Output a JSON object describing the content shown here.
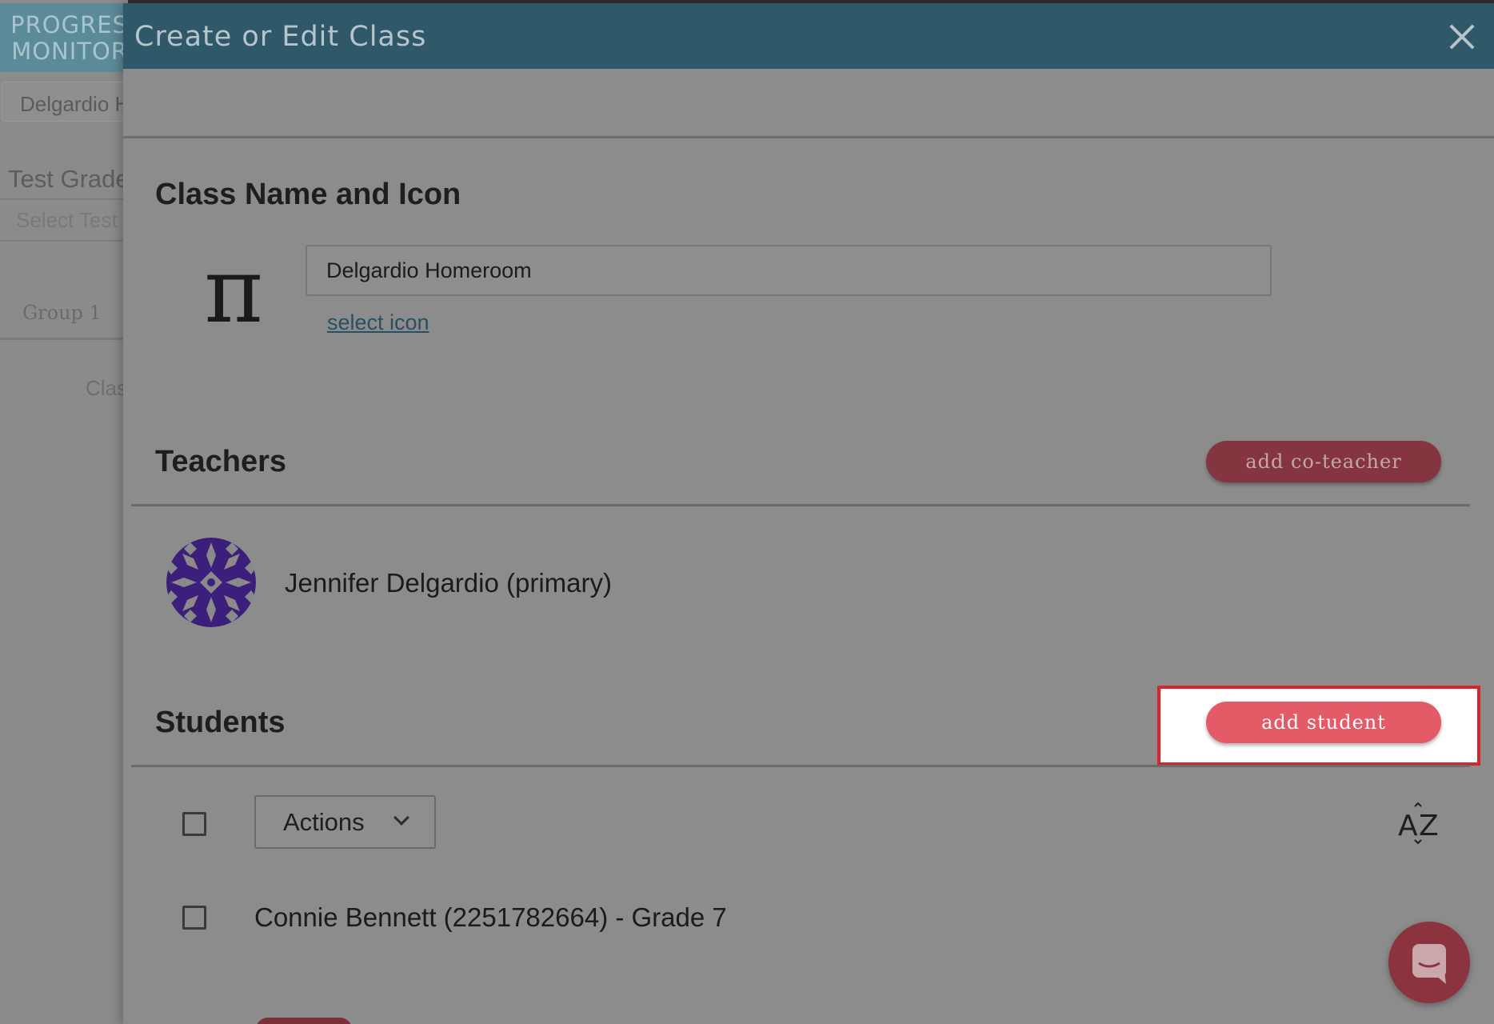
{
  "background": {
    "logo_line1": "PROGRES",
    "logo_line2": "MONITOR",
    "school_field": "Delgardio H",
    "test_label": "Test Grade",
    "select_placeholder": "Select Test",
    "group_label": "Group 1",
    "class_label": "Clas"
  },
  "modal": {
    "title": "Create or Edit Class",
    "class_section": {
      "title": "Class Name and Icon",
      "icon": "pi-icon",
      "icon_glyph": "π",
      "class_name_value": "Delgardio Homeroom",
      "select_icon_link": "select icon"
    },
    "teachers_section": {
      "title": "Teachers",
      "add_button": "add co-teacher",
      "teachers": [
        {
          "name": "Jennifer Delgardio (primary)",
          "avatar": "purple-geometric-avatar"
        }
      ]
    },
    "students_section": {
      "title": "Students",
      "add_button": "add student",
      "actions_label": "Actions",
      "sort_icon": "sort-az-icon",
      "students": [
        {
          "label": "Connie Bennett (2251782664) - Grade 7"
        }
      ]
    }
  },
  "colors": {
    "header_bg": "#2f5868",
    "co_teacher_button": "#843540",
    "add_student_button": "#e35b67",
    "highlight_border": "#d7252c",
    "chat_bubble": "#8b3440"
  }
}
